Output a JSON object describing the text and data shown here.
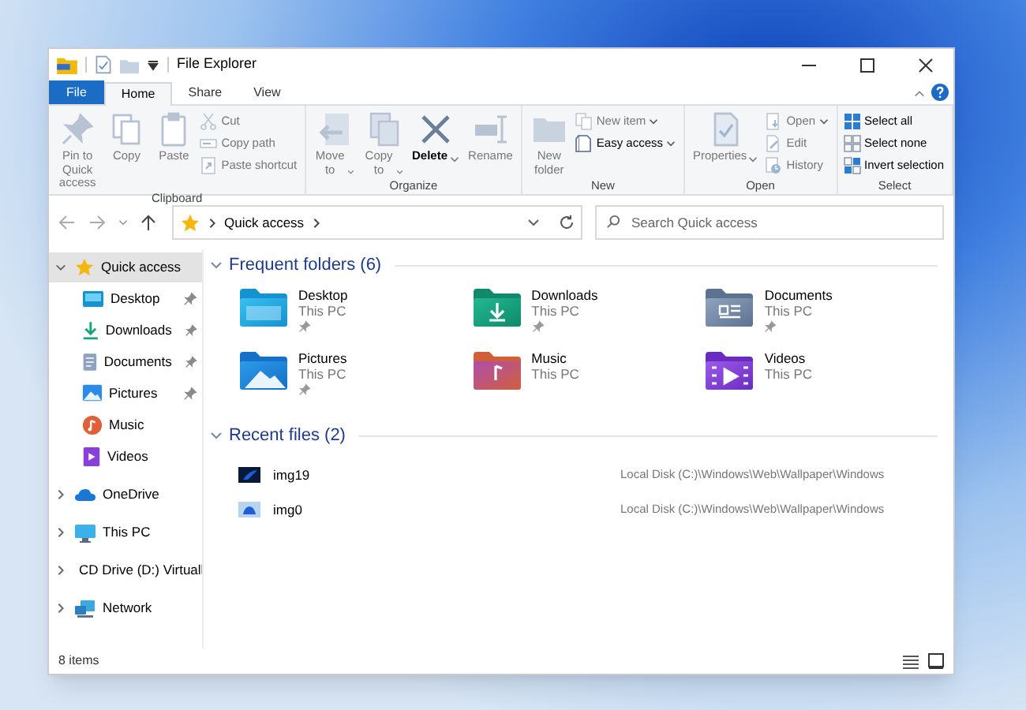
{
  "window": {
    "title": "File Explorer"
  },
  "tabs": [
    {
      "label": "File",
      "kind": "file",
      "selected": false
    },
    {
      "label": "Home",
      "kind": "tab",
      "selected": true
    },
    {
      "label": "Share",
      "kind": "tab",
      "selected": false
    },
    {
      "label": "View",
      "kind": "tab",
      "selected": false
    }
  ],
  "ribbon": {
    "groups": [
      {
        "label": "Clipboard",
        "large": [
          {
            "label": "Pin to Quick access",
            "kind": "pin",
            "disabled": true,
            "dropdown": false
          },
          {
            "label": "Copy",
            "kind": "copy",
            "disabled": true,
            "dropdown": false
          },
          {
            "label": "Paste",
            "kind": "paste",
            "disabled": true,
            "dropdown": false
          }
        ],
        "small": [
          {
            "label": "Cut",
            "kind": "cut",
            "disabled": true,
            "dropdown": false
          },
          {
            "label": "Copy path",
            "kind": "copy-path",
            "disabled": true,
            "dropdown": false
          },
          {
            "label": "Paste shortcut",
            "kind": "paste-shortcut",
            "disabled": true,
            "dropdown": false
          }
        ]
      },
      {
        "label": "Organize",
        "large": [
          {
            "label": "Move to",
            "kind": "move",
            "disabled": true,
            "dropdown": true
          },
          {
            "label": "Copy to",
            "kind": "copy-to",
            "disabled": true,
            "dropdown": true
          },
          {
            "label": "Delete",
            "kind": "delete",
            "disabled": false,
            "dropdown": true
          },
          {
            "label": "Rename",
            "kind": "rename",
            "disabled": true,
            "dropdown": false
          }
        ]
      },
      {
        "label": "New",
        "large": [
          {
            "label": "New folder",
            "kind": "new-folder",
            "disabled": true,
            "dropdown": false
          }
        ],
        "small": [
          {
            "label": "New item",
            "kind": "new-item",
            "disabled": true,
            "dropdown": true
          },
          {
            "label": "Easy access",
            "kind": "easy-access",
            "disabled": false,
            "dropdown": true
          }
        ]
      },
      {
        "label": "Open",
        "large": [
          {
            "label": "Properties",
            "kind": "properties",
            "disabled": true,
            "dropdown": true
          }
        ],
        "small": [
          {
            "label": "Open",
            "kind": "open",
            "disabled": true,
            "dropdown": true
          },
          {
            "label": "Edit",
            "kind": "edit",
            "disabled": true,
            "dropdown": false
          },
          {
            "label": "History",
            "kind": "history",
            "disabled": true,
            "dropdown": false
          }
        ]
      },
      {
        "label": "Select",
        "small": [
          {
            "label": "Select all",
            "kind": "select-all",
            "disabled": false,
            "dropdown": false
          },
          {
            "label": "Select none",
            "kind": "select-none",
            "disabled": false,
            "dropdown": false
          },
          {
            "label": "Invert selection",
            "kind": "invert",
            "disabled": false,
            "dropdown": false
          }
        ]
      }
    ]
  },
  "address": {
    "location": "Quick access"
  },
  "search": {
    "placeholder": "Search Quick access"
  },
  "navigation": [
    {
      "label": "Quick access",
      "kind": "star",
      "expanded": true,
      "selected": true,
      "children": [
        {
          "label": "Desktop",
          "kind": "desktop",
          "pinned": true,
          "selected": false
        },
        {
          "label": "Downloads",
          "kind": "downloads",
          "pinned": true,
          "selected": false
        },
        {
          "label": "Documents",
          "kind": "documents",
          "pinned": true,
          "selected": false
        },
        {
          "label": "Pictures",
          "kind": "pictures",
          "pinned": true,
          "selected": false
        },
        {
          "label": "Music",
          "kind": "music",
          "pinned": false,
          "selected": false
        },
        {
          "label": "Videos",
          "kind": "videos",
          "pinned": false,
          "selected": false
        }
      ]
    },
    {
      "label": "OneDrive",
      "kind": "cloud",
      "expanded": false,
      "selected": false
    },
    {
      "label": "This PC",
      "kind": "pc",
      "expanded": false,
      "selected": false
    },
    {
      "label": "CD Drive (D:) Virtuall",
      "kind": "cd",
      "expanded": false,
      "selected": false
    },
    {
      "label": "Network",
      "kind": "network",
      "expanded": false,
      "selected": false
    }
  ],
  "frequent_folders": {
    "title": "Frequent folders (6)",
    "expanded": true,
    "items": [
      {
        "name": "Desktop",
        "location": "This PC",
        "kind": "desktop",
        "pinned": true
      },
      {
        "name": "Downloads",
        "location": "This PC",
        "kind": "downloads",
        "pinned": true
      },
      {
        "name": "Documents",
        "location": "This PC",
        "kind": "documents",
        "pinned": true
      },
      {
        "name": "Pictures",
        "location": "This PC",
        "kind": "pictures",
        "pinned": true
      },
      {
        "name": "Music",
        "location": "This PC",
        "kind": "music",
        "pinned": false
      },
      {
        "name": "Videos",
        "location": "This PC",
        "kind": "videos",
        "pinned": false
      }
    ]
  },
  "recent_files": {
    "title": "Recent files (2)",
    "expanded": true,
    "items": [
      {
        "name": "img19",
        "path": "Local Disk (C:)\\Windows\\Web\\Wallpaper\\Windows",
        "kind": "dark"
      },
      {
        "name": "img0",
        "path": "Local Disk (C:)\\Windows\\Web\\Wallpaper\\Windows",
        "kind": "light"
      }
    ]
  },
  "status_bar": {
    "text": "8 items"
  }
}
